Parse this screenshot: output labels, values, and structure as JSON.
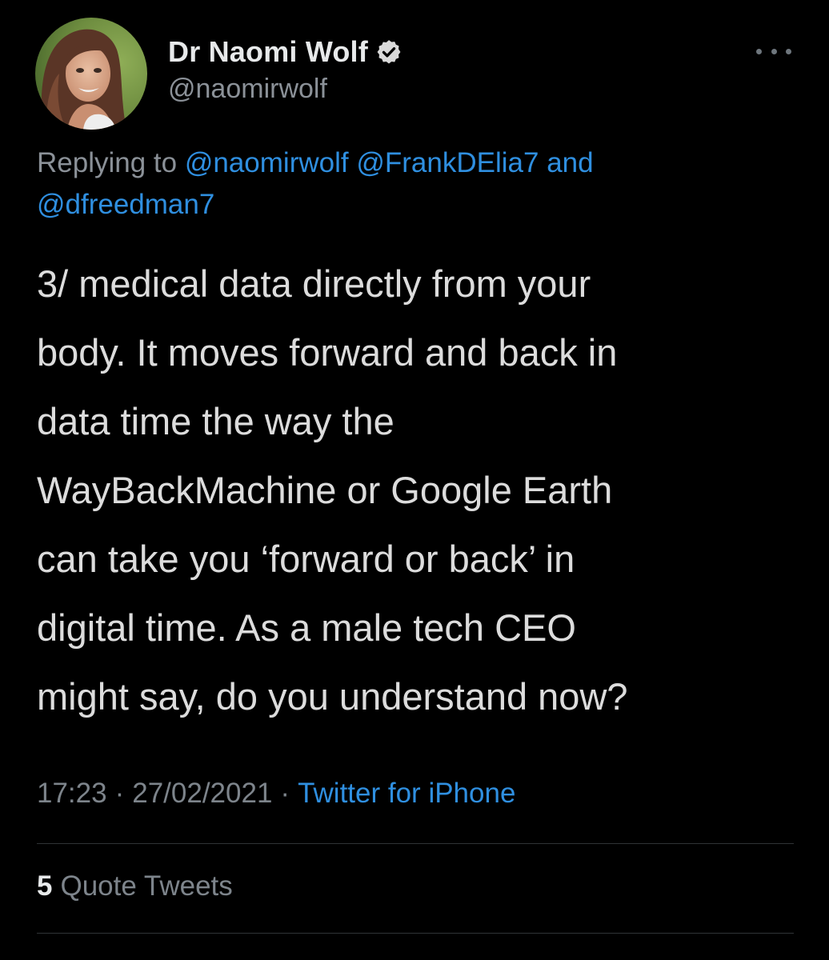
{
  "author": {
    "display_name": "Dr Naomi Wolf",
    "handle": "@naomirwolf",
    "verified": true
  },
  "more_icon": "more-horizontal-icon",
  "reply_context": {
    "prefix": "Replying to",
    "mention_1": "@naomirwolf",
    "mention_2": "@FrankDElia7",
    "conjunction": "and",
    "mention_3": "@dfreedman7"
  },
  "tweet_text_lines": [
    "3/ medical data directly from your",
    "body. It moves forward and back in",
    "data time the way the",
    "WayBackMachine or Google Earth",
    "can take you ‘forward or back’ in",
    "digital time. As a male tech CEO",
    "might say, do you understand now?"
  ],
  "meta": {
    "time": "17:23",
    "separator": "·",
    "date": "27/02/2021",
    "source": "Twitter for iPhone"
  },
  "stats": {
    "quote_count": "5",
    "quote_label": "Quote Tweets"
  },
  "colors": {
    "background": "#000000",
    "link": "#2f8fe0",
    "secondary_text": "#8b9198",
    "verified_badge": "#d9d9d9",
    "divider": "#2f3336"
  }
}
